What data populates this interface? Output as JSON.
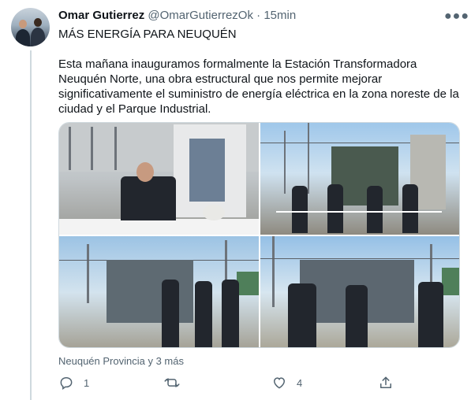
{
  "author": {
    "name": "Omar Gutierrez",
    "handle": "@OmarGutierrezOk",
    "separator": "·",
    "time": "15min"
  },
  "tweet": {
    "title": "MÁS ENERGÍA PARA NEUQUÉN",
    "body": "Esta mañana inauguramos formalmente la Estación Transformadora Neuquén Norte, una obra estructural que nos permite mejorar significativamente el suministro de energía eléctrica en la zona noreste de la ciudad y el Parque Industrial.",
    "location": "Neuquén Provincia y 3 más"
  },
  "actions": {
    "reply_count": "1",
    "retweet_count": "",
    "like_count": "4"
  },
  "icons": {
    "more": "more-icon",
    "reply": "reply-icon",
    "retweet": "retweet-icon",
    "like": "heart-icon",
    "share": "share-icon"
  },
  "colors": {
    "text": "#0f1419",
    "secondary": "#536471",
    "border": "#cfd9de"
  }
}
